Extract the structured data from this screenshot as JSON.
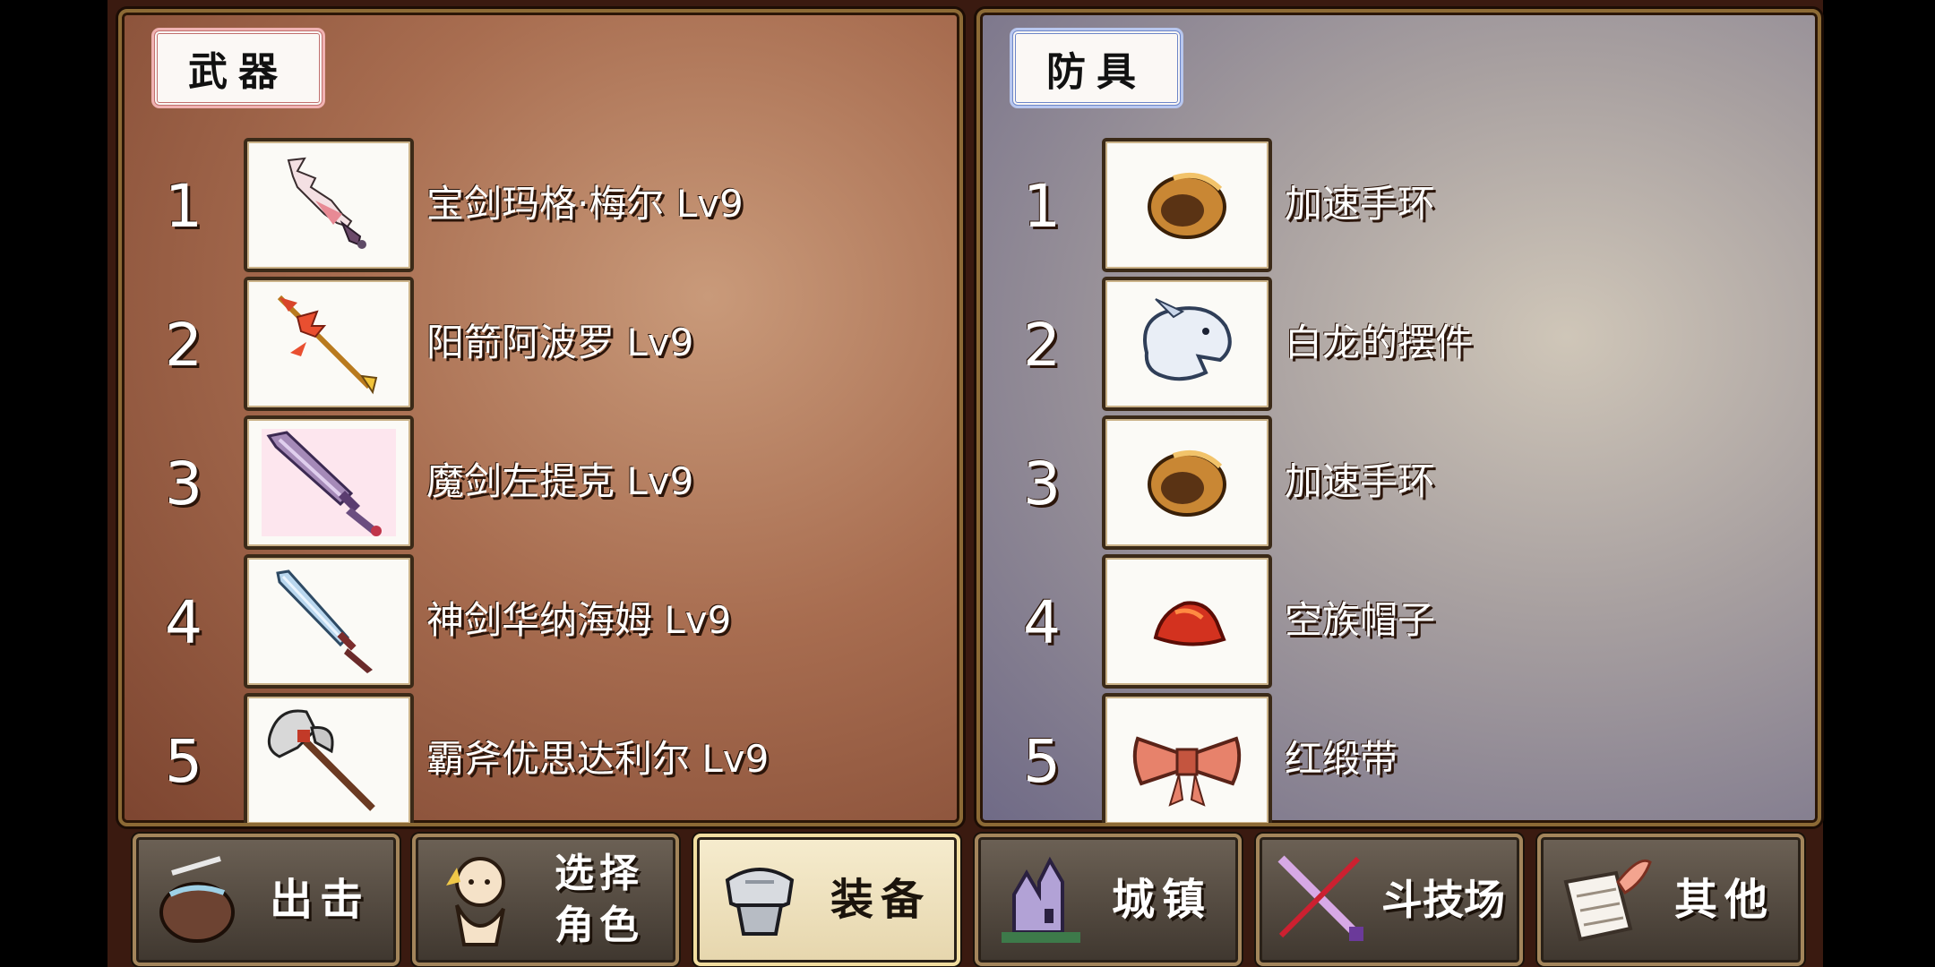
{
  "weapons": {
    "title": "武器",
    "items": [
      {
        "num": "1",
        "name": "宝剑玛格·梅尔 Lv9",
        "icon": "pink-sword-icon"
      },
      {
        "num": "2",
        "name": "阳箭阿波罗 Lv9",
        "icon": "golden-arrow-icon"
      },
      {
        "num": "3",
        "name": "魔剑左提克 Lv9",
        "icon": "purple-greatsword-icon"
      },
      {
        "num": "4",
        "name": "神剑华纳海姆 Lv9",
        "icon": "blue-sword-icon"
      },
      {
        "num": "5",
        "name": "霸斧优思达利尔 Lv9",
        "icon": "battle-axe-icon"
      }
    ]
  },
  "armor": {
    "title": "防具",
    "items": [
      {
        "num": "1",
        "name": "加速手环",
        "icon": "bracelet-icon"
      },
      {
        "num": "2",
        "name": "白龙的摆件",
        "icon": "white-dragon-icon"
      },
      {
        "num": "3",
        "name": "加速手环",
        "icon": "bracelet-icon"
      },
      {
        "num": "4",
        "name": "空族帽子",
        "icon": "red-hat-icon"
      },
      {
        "num": "5",
        "name": "红缎带",
        "icon": "ribbon-icon"
      }
    ]
  },
  "nav": {
    "sortie": "出击",
    "select_line1": "选择",
    "select_line2": "角色",
    "equip": "装备",
    "town": "城镇",
    "arena": "斗技场",
    "other": "其他"
  }
}
